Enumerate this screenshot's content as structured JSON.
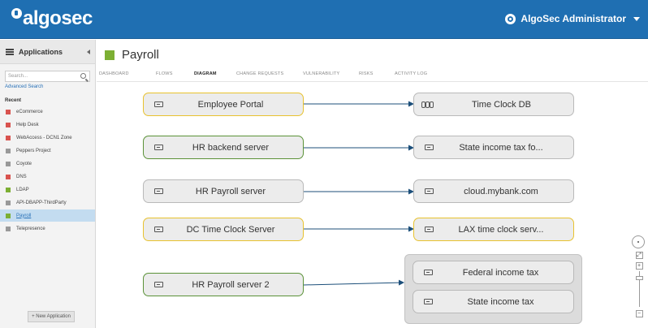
{
  "header": {
    "logo_text": "algosec",
    "user_name": "AlgoSec Administrator",
    "icons": [
      "settings-gear-icon",
      "chevron-down-icon"
    ]
  },
  "sidebar": {
    "title": "Applications",
    "search_placeholder": "Search...",
    "advanced_search": "Advanced Search",
    "recent_label": "Recent",
    "items": [
      {
        "label": "eCommerce",
        "color": "#d9534f"
      },
      {
        "label": "Help Desk",
        "color": "#d9534f"
      },
      {
        "label": "WebAccess - DCN1 Zone",
        "color": "#d9534f"
      },
      {
        "label": "Peppers Project",
        "color": "#999999"
      },
      {
        "label": "Coyote",
        "color": "#999999"
      },
      {
        "label": "DNS",
        "color": "#d9534f"
      },
      {
        "label": "LDAP",
        "color": "#7caf33"
      },
      {
        "label": "API-DBAPP-ThirdParty",
        "color": "#999999"
      },
      {
        "label": "Payroll",
        "color": "#7caf33",
        "active": true
      },
      {
        "label": "Telepresence",
        "color": "#999999"
      }
    ],
    "new_application": "+ New Application"
  },
  "main": {
    "title": "Payroll",
    "title_color": "#7caf33",
    "tabs": [
      {
        "label": "DASHBOARD"
      },
      {
        "label": "FLOWS"
      },
      {
        "label": "DIAGRAM",
        "active": true
      },
      {
        "label": "CHANGE REQUESTS"
      },
      {
        "label": "VULNERABILITY"
      },
      {
        "label": "RISKS"
      },
      {
        "label": "ACTIVITY LOG"
      }
    ]
  },
  "diagram": {
    "sources": [
      {
        "label": "Employee Portal",
        "border": "yellow"
      },
      {
        "label": "HR backend server",
        "border": "green"
      },
      {
        "label": "HR Payroll server",
        "border": "gray"
      },
      {
        "label": "DC Time Clock Server",
        "border": "yellow"
      },
      {
        "label": "HR Payroll server 2",
        "border": "green"
      }
    ],
    "targets": [
      {
        "label": "Time Clock DB",
        "border": "gray",
        "icon": "database-icon"
      },
      {
        "label": "State income tax fo...",
        "border": "gray",
        "icon": "server-icon"
      },
      {
        "label": "cloud.mybank.com",
        "border": "gray",
        "icon": "server-icon"
      },
      {
        "label": "LAX time clock serv...",
        "border": "yellow",
        "icon": "server-icon"
      }
    ],
    "group_targets": [
      {
        "label": "Federal income tax",
        "border": "gray"
      },
      {
        "label": "State income tax",
        "border": "gray"
      }
    ],
    "colors": {
      "yellow": "#e8c22e",
      "green": "#5b9238",
      "gray": "#b9b9b9",
      "link": "#1c4f7a"
    }
  }
}
